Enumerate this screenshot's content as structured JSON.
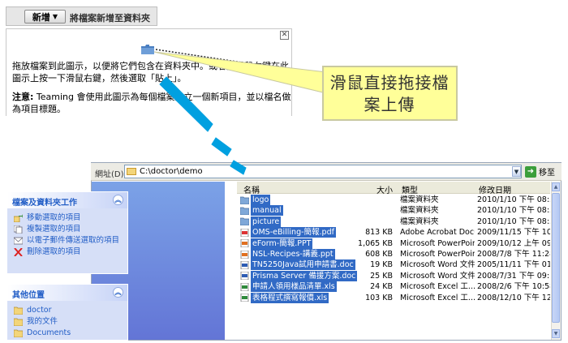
{
  "top_panel": {
    "new_button_label": "新增",
    "tab_label": "將檔案新增至資料夾",
    "close_symbol": "✕",
    "instructions": "拖放檔案到此圖示，以便將它們包含在資料夾中。或者按滑鼠右鍵在此圖示上按一下滑鼠右鍵，然後選取「貼上」。",
    "note_label": "注意:",
    "note_text": " Teaming 會使用此圖示為每個檔案建立一個新項目，並以檔名做為項目標題。"
  },
  "callout": {
    "line1": "滑鼠直接拖接檔",
    "line2": "案上傳"
  },
  "explorer": {
    "address_label": "網址(D)",
    "address_value": "C:\\doctor\\demo",
    "go_label": "移至",
    "tasks_title": "檔案及資料夾工作",
    "tasks": [
      {
        "label": "移動選取的項目",
        "icon": "move-icon"
      },
      {
        "label": "複製選取的項目",
        "icon": "copy-icon"
      },
      {
        "label": "以電子郵件傳送選取的項目",
        "icon": "email-icon"
      },
      {
        "label": "刪除選取的項目",
        "icon": "delete-icon"
      }
    ],
    "places_title": "其他位置",
    "places": [
      {
        "label": "doctor",
        "icon": "folder-icon"
      },
      {
        "label": "我的文件",
        "icon": "folder-icon"
      },
      {
        "label": "Documents",
        "icon": "folder-icon"
      }
    ],
    "columns": {
      "name": "名稱",
      "size": "大小",
      "type": "類型",
      "modified": "修改日期"
    },
    "files": [
      {
        "name": "logo",
        "size": "",
        "type": "檔案資料夾",
        "modified": "2010/1/10 下午 08:50",
        "icon": "folder"
      },
      {
        "name": "manual",
        "size": "",
        "type": "檔案資料夾",
        "modified": "2010/1/10 下午 08:54",
        "icon": "folder"
      },
      {
        "name": "picture",
        "size": "",
        "type": "檔案資料夾",
        "modified": "2010/1/10 下午 08:53",
        "icon": "folder"
      },
      {
        "name": "OMS-eBilling-簡報.pdf",
        "size": "813 KB",
        "type": "Adobe Acrobat Docu...",
        "modified": "2009/11/15 下午 10:...",
        "icon": "pdf"
      },
      {
        "name": "eForm-簡報.PPT",
        "size": "1,065 KB",
        "type": "Microsoft PowerPoin...",
        "modified": "2009/10/12 上午 09:...",
        "icon": "ppt"
      },
      {
        "name": "NSL-Recipes-講義.ppt",
        "size": "608 KB",
        "type": "Microsoft PowerPoin...",
        "modified": "2008/7/8 下午 11:28",
        "icon": "ppt"
      },
      {
        "name": "TN5250Java試用申請書.doc",
        "size": "19 KB",
        "type": "Microsoft Word 文件",
        "modified": "2005/11/11 下午 01:...",
        "icon": "doc"
      },
      {
        "name": "Prisma Server 備援方案.doc",
        "size": "25 KB",
        "type": "Microsoft Word 文件",
        "modified": "2008/7/31 下午 09:13",
        "icon": "doc"
      },
      {
        "name": "申請人領用樣品清單.xls",
        "size": "24 KB",
        "type": "Microsoft Excel 工...",
        "modified": "2008/2/6 下午 10:58",
        "icon": "xls"
      },
      {
        "name": "表格程式撰寫報價.xls",
        "size": "103 KB",
        "type": "Microsoft Excel 工...",
        "modified": "2008/12/10 下午 12:...",
        "icon": "xls"
      }
    ]
  },
  "colors": {
    "selection": "#316ac5",
    "callout_fill": "#ffff99",
    "callout_border": "#c9c9a0",
    "arrow_fill": "#00a0e0",
    "task_link": "#215dc6"
  }
}
